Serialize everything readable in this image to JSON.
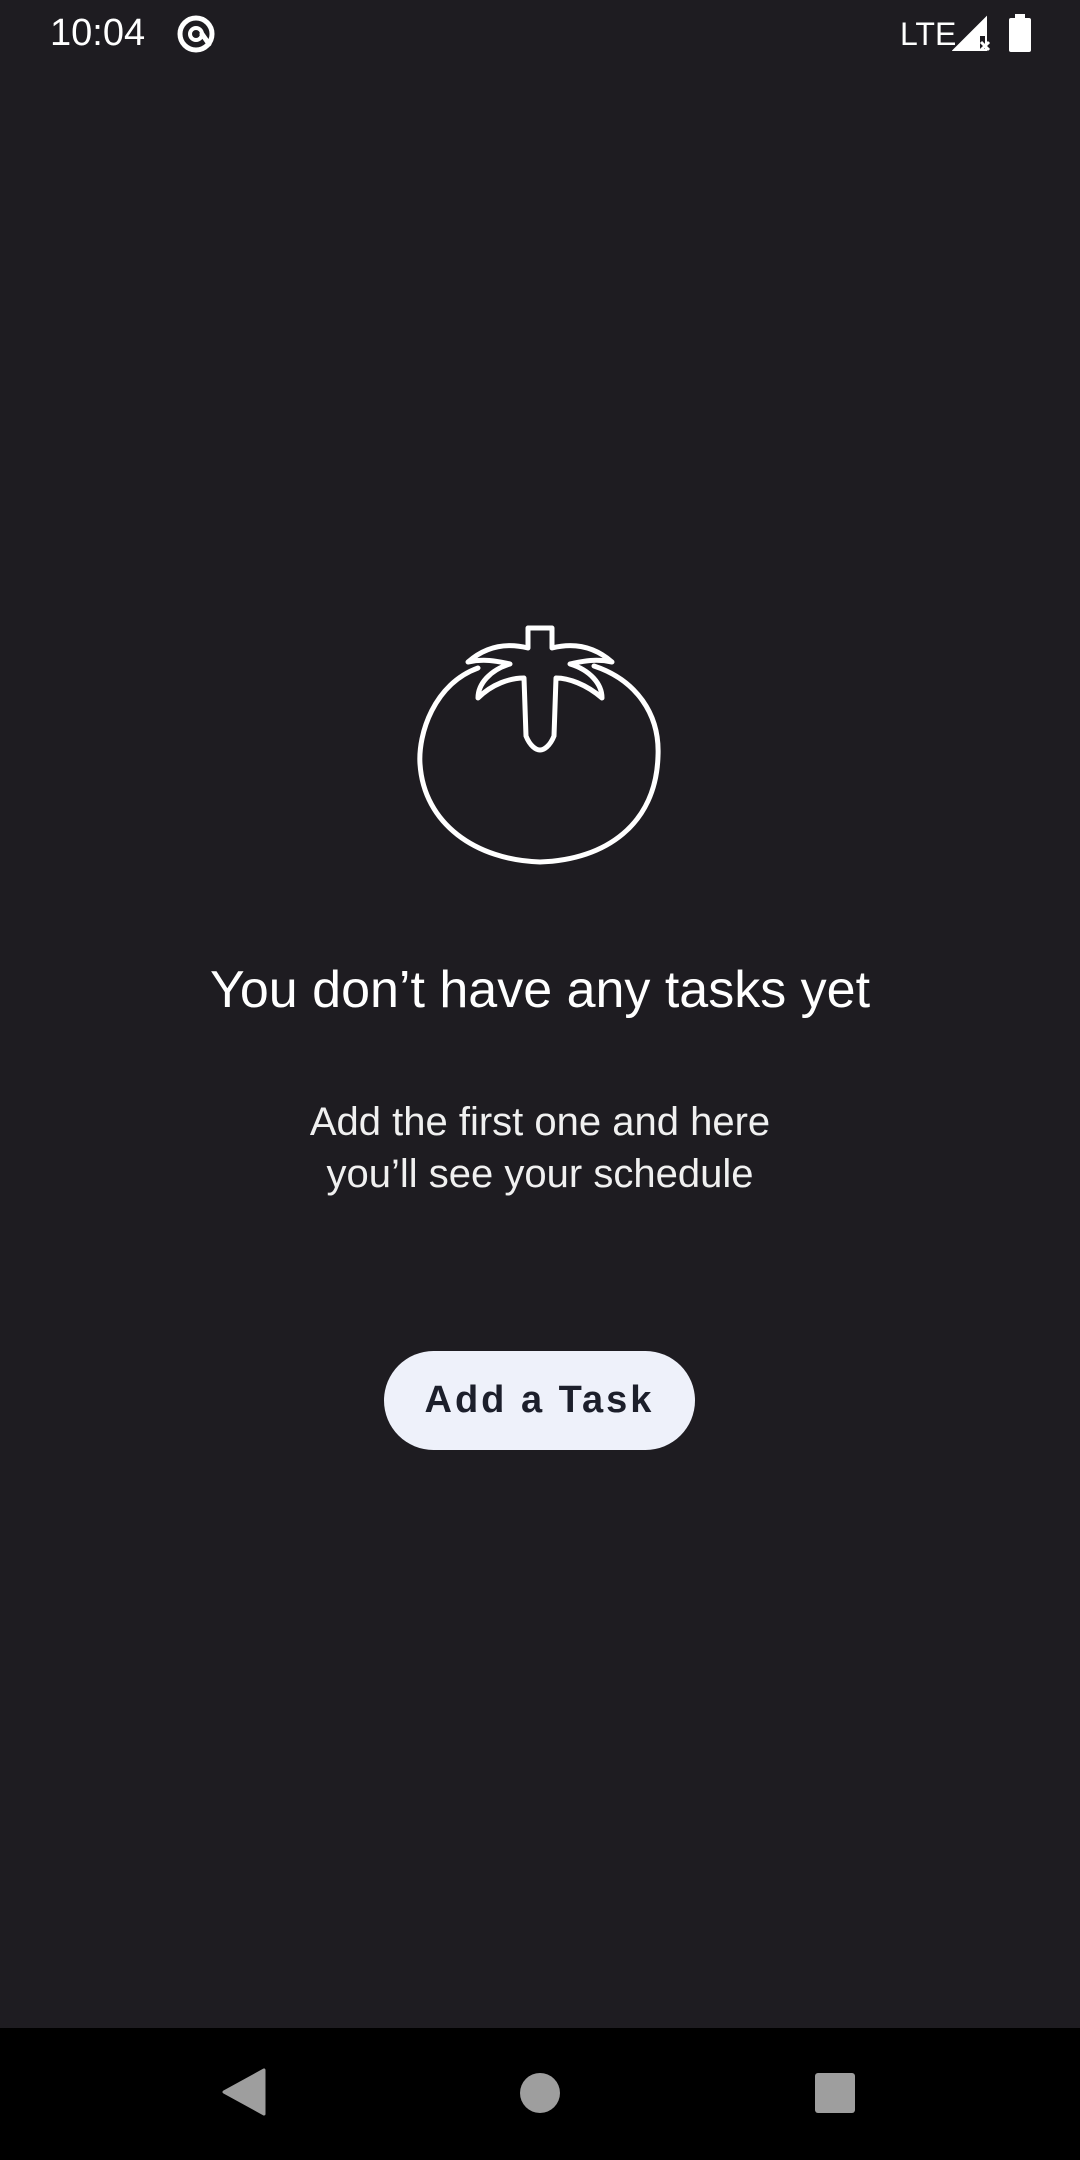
{
  "status_bar": {
    "time": "10:04",
    "network": "LTE",
    "icons": [
      "at-sign-icon",
      "signal-icon",
      "battery-icon"
    ]
  },
  "empty_state": {
    "icon": "tomato-icon",
    "title": "You don’t have any tasks yet",
    "subtitle_line1": "Add the first one and here",
    "subtitle_line2": "you’ll see your schedule",
    "button_label": "Add a Task"
  },
  "nav_bar": {
    "icons": [
      "back-icon",
      "home-icon",
      "recents-icon"
    ]
  },
  "colors": {
    "background": "#1e1c21",
    "button_bg": "#eef1fa",
    "button_text": "#1c1f2b",
    "nav_bg": "#000000",
    "nav_icon": "#9e9e9e"
  }
}
